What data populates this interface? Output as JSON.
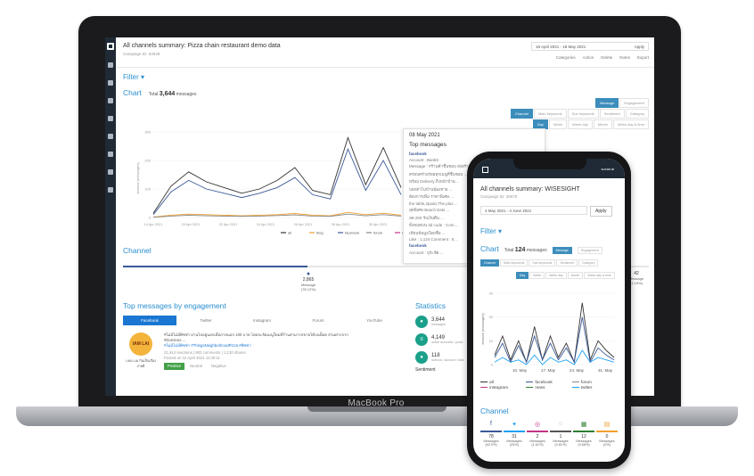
{
  "laptop": {
    "model": "MacBook Pro",
    "title": "All channels summary: Pizza chain restaurant demo data",
    "subtitle": "Campaign ID: 63548",
    "date_range": "18 April 2021 - 18 May 2021",
    "apply": "Apply",
    "toolbar": [
      "Categories",
      "Action",
      "Delete",
      "Notes",
      "Export"
    ],
    "filter": "Filter",
    "chart": {
      "title": "Chart",
      "total_label": "Total",
      "total_value": "3,644",
      "total_unit": "messages",
      "tabs_row1": [
        "Message",
        "Engagement"
      ],
      "tabs_row2": [
        "Channel",
        "Main keywords",
        "Sub keywords",
        "Sentiment",
        "Category"
      ],
      "tabs_row3": [
        "Day",
        "Week",
        "Week day",
        "Month",
        "Week day & time"
      ],
      "xlabels": [
        "14 Apr 2021",
        "20 Apr 2021",
        "22 Apr 2021",
        "24 Apr 2021",
        "26 Apr 2021",
        "28 Apr 2021",
        "30 Apr 2021",
        "2 May 2021",
        "4 May 2021",
        "12 May 2021"
      ],
      "ylabel": "amount (messages)",
      "yticks": [
        "300",
        "200",
        "100",
        "0"
      ],
      "legend": [
        "all",
        "blog",
        "facebook",
        "forum",
        "ins"
      ]
    },
    "popover": {
      "date": "08 May 2021",
      "heading": "Top messages",
      "source1": "facebook",
      "lines": [
        "Account : BankS",
        "Message : #ร้านค้าชื่นชอบ ส่งสร้างสรรค์ ...",
        "ครอบครัวอร่อยทุกเมนูที่ชื่นชอบ ...",
        "พร้อม Delivery ถึงหน้าบ้าน ...",
        "บอกตัวไปบ้านน้องชาย ...",
        "ต้องการเพิ่ม ราคาพิเศษ ...",
        "the table,2pudo,The plus ...",
        "สุดพิเศษ Beach Eats ...",
        "ลด 200 รับเงินคืน ...",
        "ทั้งหมดบน 3d code : Com...",
        "เขียนข้อมูลโดยชื่อ ...",
        "Like : 1,124  Comment : 5..."
      ],
      "source2": "facebook",
      "lines2": [
        "Account : ปุระชัย ..."
      ]
    },
    "chart_data": {
      "type": "line",
      "x": [
        "14 Apr",
        "16 Apr",
        "18 Apr",
        "20 Apr",
        "22 Apr",
        "24 Apr",
        "26 Apr",
        "28 Apr",
        "30 Apr",
        "2 May",
        "4 May",
        "6 May",
        "8 May",
        "10 May",
        "12 May"
      ],
      "series": [
        {
          "name": "all",
          "values": [
            15,
            110,
            160,
            125,
            105,
            85,
            100,
            130,
            175,
            95,
            80,
            280,
            115,
            245,
            105
          ]
        },
        {
          "name": "facebook",
          "values": [
            10,
            90,
            130,
            100,
            85,
            70,
            85,
            105,
            140,
            80,
            65,
            240,
            95,
            200,
            80
          ]
        },
        {
          "name": "blog",
          "values": [
            2,
            8,
            12,
            10,
            8,
            6,
            8,
            10,
            14,
            8,
            6,
            18,
            10,
            15,
            8
          ]
        },
        {
          "name": "forum",
          "values": [
            1,
            5,
            8,
            6,
            5,
            4,
            5,
            7,
            9,
            5,
            4,
            12,
            6,
            10,
            5
          ]
        }
      ],
      "ylim": [
        0,
        300
      ]
    },
    "channel": {
      "title": "Channel",
      "items": [
        {
          "icon": "facebook-icon",
          "value": "2,865",
          "label": "Message",
          "pct": "(78.12%)"
        },
        {
          "icon": "instagram-icon",
          "value": "2",
          "label": "Message",
          "pct": "(0.06%)"
        },
        {
          "icon": "youtube-icon",
          "value": "42",
          "label": "Message",
          "pct": "(1.15%)"
        }
      ]
    },
    "top_messages": {
      "title": "Top messages by engagement",
      "tabs": [
        "Facebook",
        "Twitter",
        "Instagram",
        "Forum",
        "YouTube"
      ],
      "avatar_text": "IAM LAI",
      "account": "I AM LAI  กินเป็นเรื่องง่ายดี",
      "body": "#ไม่มีไม่มีพิซซ่า ผ่านไปอยู่นอกเมื่อภายนอก 100 บาท โดยจะจัดเมนูใหม่ที่ร้านสามารถขายได้บนพ็อต ส่วนต่างจาก #Dominos ...",
      "hashtags": "#ไม่มีไม่มีพิซซ่า #ThingsNeighborhoodPizza #พิซซ่า",
      "stats": "21,914 reactions  |  902 comments  |  1,130 shares",
      "posted": "Posted on 22 April 2021 11:00:11",
      "sentiment_tabs": [
        "Positive",
        "Neutral",
        "Negative"
      ]
    },
    "statistics": {
      "title": "Statistics",
      "items": [
        {
          "value": "3,644",
          "label": "messages"
        },
        {
          "value": "4,149",
          "label": "active accounts / posts"
        },
        {
          "value": "118",
          "label": "authors / account / total"
        }
      ],
      "sentiment": "Sentiment"
    }
  },
  "phone": {
    "status": "social.ai",
    "title": "All channels summary: WISESIGHT",
    "subtitle": "Campaign ID: 36570",
    "date_range": "4 May 2021 - 4 June 2021",
    "apply": "Apply",
    "filter": "Filter",
    "chart_title": "Chart",
    "total_label": "Total",
    "total_value": "124",
    "total_unit": "messages",
    "tabs_row1": [
      "Message",
      "Engagement"
    ],
    "tabs_row2": [
      "Channel",
      "Main keywords",
      "Sub keywords",
      "Sentiment",
      "Category"
    ],
    "tabs_row3": [
      "Day",
      "Week",
      "Week day",
      "Month",
      "Week day & time"
    ],
    "xticks": [
      "10. May",
      "17. May",
      "24. May",
      "31. May"
    ],
    "ylabel": "amount (messages)",
    "yticks": [
      "30",
      "20",
      "10",
      "0"
    ],
    "legend": [
      "all",
      "facebook",
      "forum",
      "instagram",
      "news",
      "twitter"
    ],
    "chart_data": {
      "type": "line",
      "x": [
        "4 May",
        "6 May",
        "8 May",
        "10 May",
        "12 May",
        "14 May",
        "16 May",
        "18 May",
        "20 May",
        "22 May",
        "24 May",
        "26 May",
        "28 May",
        "30 May",
        "1 Jun",
        "3 Jun"
      ],
      "series": [
        {
          "name": "all",
          "values": [
            4,
            12,
            2,
            10,
            1,
            16,
            2,
            12,
            3,
            9,
            1,
            26,
            2,
            10,
            6,
            3
          ]
        },
        {
          "name": "facebook",
          "values": [
            3,
            9,
            1,
            8,
            1,
            12,
            2,
            9,
            2,
            7,
            1,
            20,
            1,
            7,
            4,
            2
          ]
        },
        {
          "name": "twitter",
          "values": [
            1,
            3,
            1,
            2,
            0,
            4,
            0,
            3,
            1,
            2,
            0,
            6,
            1,
            3,
            2,
            1
          ]
        }
      ],
      "ylim": [
        0,
        30
      ]
    },
    "channel_title": "Channel",
    "channels": [
      {
        "icon": "facebook-icon",
        "value": "78",
        "label": "Messages",
        "pct": "(62.9%)",
        "color": "#3b5998"
      },
      {
        "icon": "twitter-icon",
        "value": "31",
        "label": "Messages",
        "pct": "(25%)",
        "color": "#1da1f2"
      },
      {
        "icon": "instagram-icon",
        "value": "2",
        "label": "Messages",
        "pct": "(1.61%)",
        "color": "#c13584"
      },
      {
        "icon": "forum-icon",
        "value": "1",
        "label": "Messages",
        "pct": "(0.81%)",
        "color": "#555555"
      },
      {
        "icon": "news-icon",
        "value": "12",
        "label": "Messages",
        "pct": "(9.68%)",
        "color": "#2e7d32"
      },
      {
        "icon": "blog-icon",
        "value": "0",
        "label": "Messages",
        "pct": "(0%)",
        "color": "#f0a030"
      }
    ]
  },
  "colors": {
    "accent": "#2a8fd0",
    "nav": "#1f2a36",
    "tab_active": "#3c8dbc"
  }
}
